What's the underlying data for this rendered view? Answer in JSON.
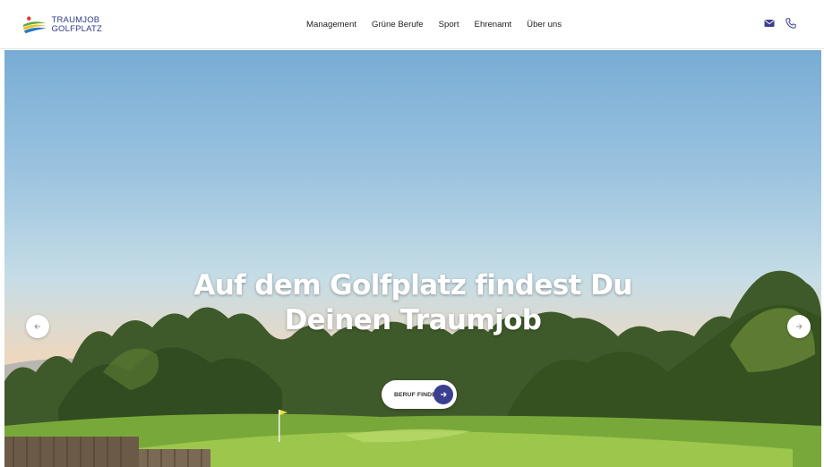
{
  "logo": {
    "line1": "TRAUMJOB",
    "line2": "GOLFPLATZ"
  },
  "nav": {
    "items": [
      "Management",
      "Grüne Berufe",
      "Sport",
      "Ehrenamt",
      "Über uns"
    ]
  },
  "header_icons": [
    "mail-icon",
    "phone-icon"
  ],
  "hero": {
    "title_line1": "Auf dem Golfplatz findest Du",
    "title_line2": "Deinen Traumjob",
    "cta_label": "BERUF FINDEN"
  },
  "colors": {
    "brand": "#2f3a8a",
    "cta_arrow": "#3b3f8f",
    "logo_green": "#5aa83a",
    "logo_blue": "#2a7ac0",
    "logo_yellow": "#f0c020"
  }
}
